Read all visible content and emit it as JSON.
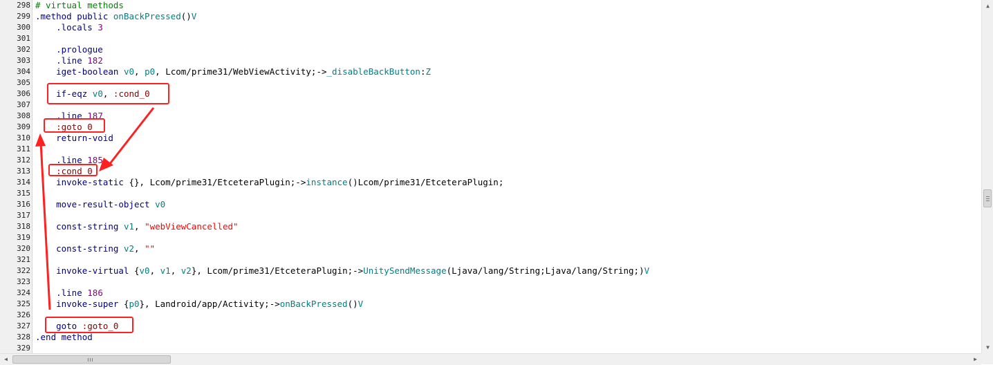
{
  "editor": {
    "lines": [
      {
        "n": "298",
        "tokens": [
          [
            "t-comment",
            "# virtual methods"
          ]
        ]
      },
      {
        "n": "299",
        "tokens": [
          [
            "t-dir",
            ".method public "
          ],
          [
            "t-meth",
            "onBackPressed"
          ],
          [
            "t-plain",
            "()"
          ],
          [
            "t-meth",
            "V"
          ]
        ]
      },
      {
        "n": "300",
        "tokens": [
          [
            "t-dir",
            "    .locals "
          ],
          [
            "t-num",
            "3"
          ]
        ]
      },
      {
        "n": "301",
        "tokens": []
      },
      {
        "n": "302",
        "tokens": [
          [
            "t-dir",
            "    .prologue"
          ]
        ]
      },
      {
        "n": "303",
        "tokens": [
          [
            "t-dir",
            "    .line "
          ],
          [
            "t-num",
            "182"
          ]
        ]
      },
      {
        "n": "304",
        "tokens": [
          [
            "t-op",
            "    iget-boolean "
          ],
          [
            "t-reg",
            "v0"
          ],
          [
            "t-plain",
            ", "
          ],
          [
            "t-reg",
            "p0"
          ],
          [
            "t-plain",
            ", "
          ],
          [
            "t-cls",
            "Lcom/prime31/WebViewActivity;"
          ],
          [
            "t-plain",
            "->"
          ],
          [
            "t-meth",
            "_disableBackButton"
          ],
          [
            "t-plain",
            ":"
          ],
          [
            "t-meth",
            "Z"
          ]
        ]
      },
      {
        "n": "305",
        "tokens": []
      },
      {
        "n": "306",
        "tokens": [
          [
            "t-op",
            "    if-eqz "
          ],
          [
            "t-reg",
            "v0"
          ],
          [
            "t-plain",
            ", "
          ],
          [
            "t-label",
            ":cond_0"
          ]
        ]
      },
      {
        "n": "307",
        "tokens": []
      },
      {
        "n": "308",
        "tokens": [
          [
            "t-dir",
            "    .line "
          ],
          [
            "t-num",
            "187"
          ]
        ]
      },
      {
        "n": "309",
        "tokens": [
          [
            "t-label",
            "    :goto_0"
          ]
        ]
      },
      {
        "n": "310",
        "tokens": [
          [
            "t-op",
            "    return-void"
          ]
        ]
      },
      {
        "n": "311",
        "tokens": []
      },
      {
        "n": "312",
        "tokens": [
          [
            "t-dir",
            "    .line "
          ],
          [
            "t-num",
            "185"
          ]
        ]
      },
      {
        "n": "313",
        "tokens": [
          [
            "t-label",
            "    :cond_0"
          ]
        ]
      },
      {
        "n": "314",
        "tokens": [
          [
            "t-op",
            "    invoke-static "
          ],
          [
            "t-plain",
            "{}, "
          ],
          [
            "t-cls",
            "Lcom/prime31/EtceteraPlugin;"
          ],
          [
            "t-plain",
            "->"
          ],
          [
            "t-meth",
            "instance"
          ],
          [
            "t-plain",
            "()"
          ],
          [
            "t-cls",
            "Lcom/prime31/EtceteraPlugin;"
          ]
        ]
      },
      {
        "n": "315",
        "tokens": []
      },
      {
        "n": "316",
        "tokens": [
          [
            "t-op",
            "    move-result-object "
          ],
          [
            "t-reg",
            "v0"
          ]
        ]
      },
      {
        "n": "317",
        "tokens": []
      },
      {
        "n": "318",
        "tokens": [
          [
            "t-op",
            "    const-string "
          ],
          [
            "t-reg",
            "v1"
          ],
          [
            "t-plain",
            ", "
          ],
          [
            "t-str",
            "\"webViewCancelled\""
          ]
        ]
      },
      {
        "n": "319",
        "tokens": []
      },
      {
        "n": "320",
        "tokens": [
          [
            "t-op",
            "    const-string "
          ],
          [
            "t-reg",
            "v2"
          ],
          [
            "t-plain",
            ", "
          ],
          [
            "t-str",
            "\"\""
          ]
        ]
      },
      {
        "n": "321",
        "tokens": []
      },
      {
        "n": "322",
        "tokens": [
          [
            "t-op",
            "    invoke-virtual "
          ],
          [
            "t-plain",
            "{"
          ],
          [
            "t-reg",
            "v0"
          ],
          [
            "t-plain",
            ", "
          ],
          [
            "t-reg",
            "v1"
          ],
          [
            "t-plain",
            ", "
          ],
          [
            "t-reg",
            "v2"
          ],
          [
            "t-plain",
            "}, "
          ],
          [
            "t-cls",
            "Lcom/prime31/EtceteraPlugin;"
          ],
          [
            "t-plain",
            "->"
          ],
          [
            "t-meth",
            "UnitySendMessage"
          ],
          [
            "t-plain",
            "("
          ],
          [
            "t-cls",
            "Ljava/lang/String;Ljava/lang/String;"
          ],
          [
            "t-plain",
            ")"
          ],
          [
            "t-meth",
            "V"
          ]
        ]
      },
      {
        "n": "323",
        "tokens": []
      },
      {
        "n": "324",
        "tokens": [
          [
            "t-dir",
            "    .line "
          ],
          [
            "t-num",
            "186"
          ]
        ]
      },
      {
        "n": "325",
        "tokens": [
          [
            "t-op",
            "    invoke-super "
          ],
          [
            "t-plain",
            "{"
          ],
          [
            "t-reg",
            "p0"
          ],
          [
            "t-plain",
            "}, "
          ],
          [
            "t-cls",
            "Landroid/app/Activity;"
          ],
          [
            "t-plain",
            "->"
          ],
          [
            "t-meth",
            "onBackPressed"
          ],
          [
            "t-plain",
            "()"
          ],
          [
            "t-meth",
            "V"
          ]
        ]
      },
      {
        "n": "326",
        "tokens": []
      },
      {
        "n": "327",
        "tokens": [
          [
            "t-op",
            "    goto "
          ],
          [
            "t-label",
            ":goto_0"
          ]
        ]
      },
      {
        "n": "328",
        "tokens": [
          [
            "t-dir",
            ".end method"
          ]
        ]
      },
      {
        "n": "329",
        "tokens": []
      }
    ]
  },
  "annotations": {
    "stroke_color": "#ff2020",
    "boxes": [
      "if-eqz v0, :cond_0",
      ":goto_0",
      ":cond_0",
      "goto :goto_0"
    ],
    "arrows": [
      "if-eqz to :cond_0",
      "goto :goto_0 to :goto_0"
    ]
  },
  "scrollbars": {
    "up_icon": "▲",
    "down_icon": "▼",
    "left_icon": "◀",
    "right_icon": "▶"
  }
}
